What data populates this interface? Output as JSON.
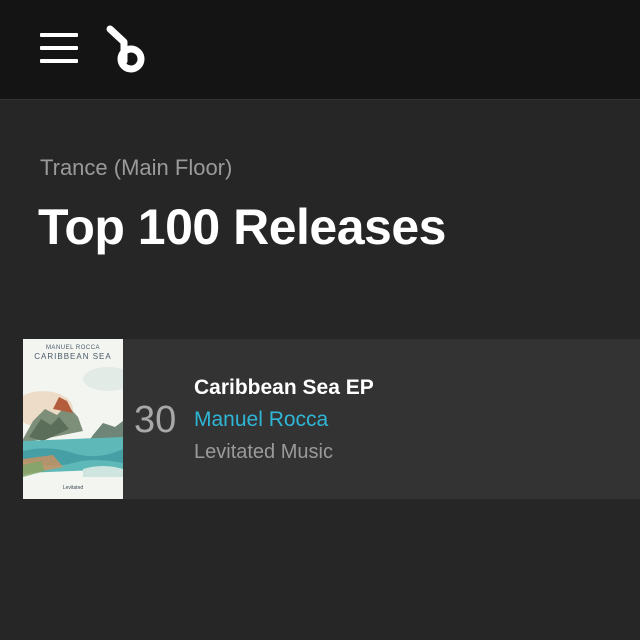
{
  "header": {
    "menu_icon": "hamburger-menu-icon",
    "logo_icon": "beatport-logo-icon"
  },
  "page": {
    "breadcrumb": "Trance (Main Floor)",
    "title": "Top 100 Releases"
  },
  "releases": [
    {
      "rank": "30",
      "title": "Caribbean Sea EP",
      "artist": "Manuel Rocca",
      "label": "Levitated Music",
      "artwork": {
        "artist_text": "MANUEL ROCCA",
        "title_text": "CARIBBEAN SEA",
        "label_text": "Levitated"
      }
    }
  ],
  "colors": {
    "background": "#262626",
    "header": "#141414",
    "card": "#333333",
    "artist_accent": "#2fb6d6"
  }
}
